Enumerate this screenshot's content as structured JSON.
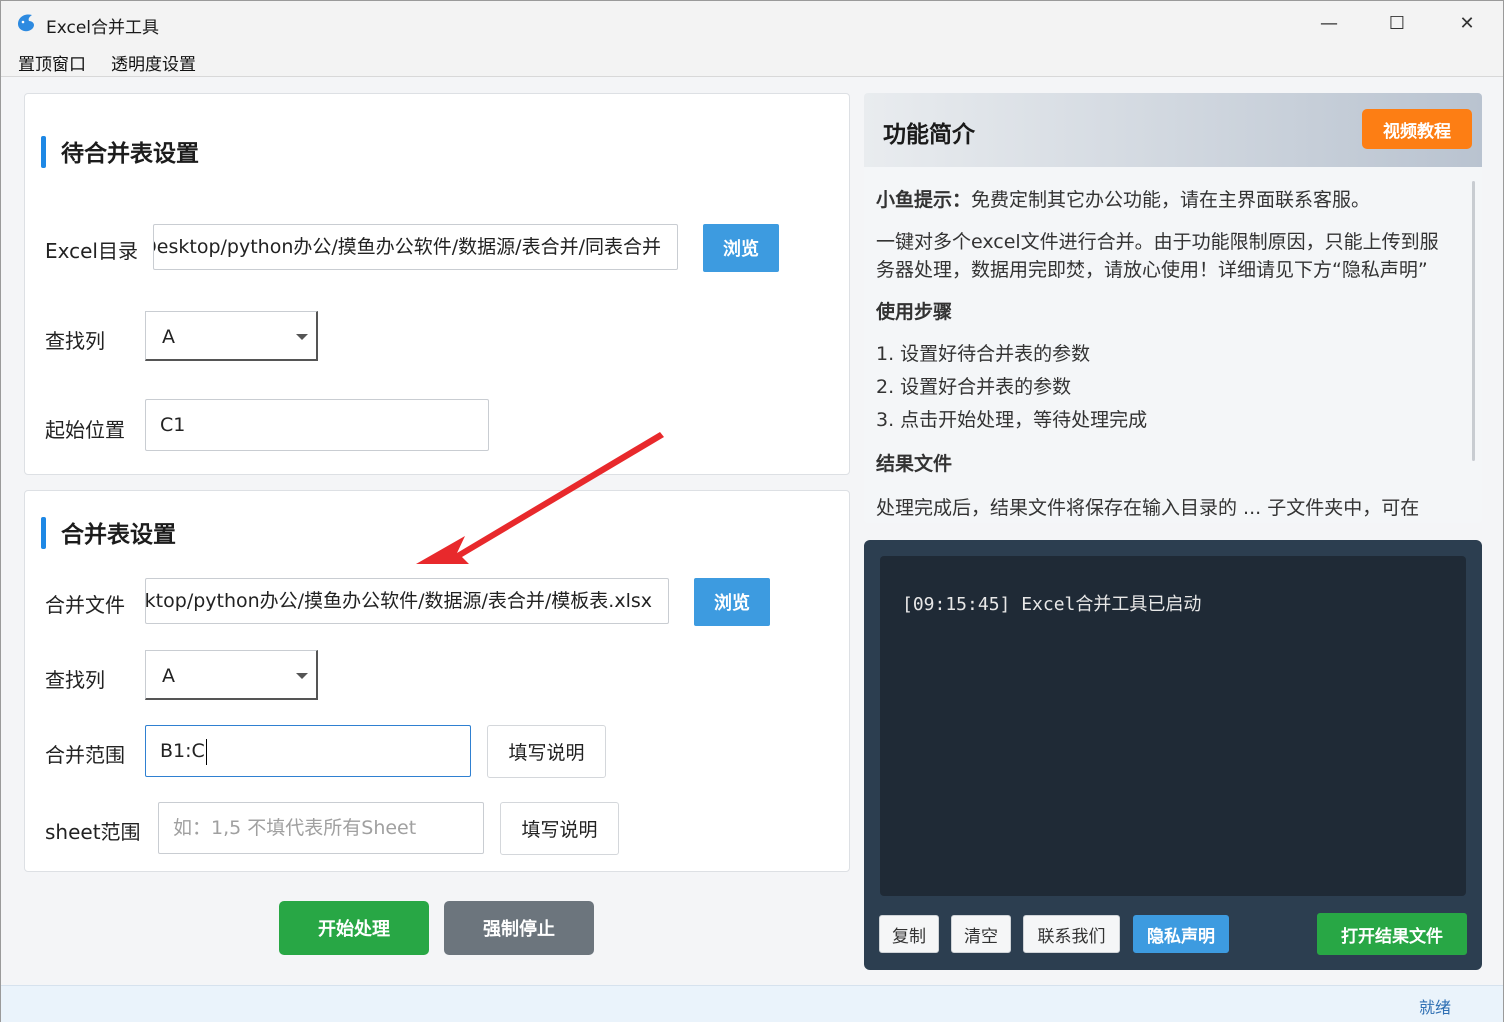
{
  "window": {
    "title": "Excel合并工具",
    "minimize_glyph": "—",
    "maximize_glyph": "☐",
    "close_glyph": "✕"
  },
  "menu": [
    "置顶窗口",
    "透明度设置"
  ],
  "source_section": {
    "title": "待合并表设置",
    "excel_dir_label": "Excel目录",
    "excel_dir_value": "C:/Users/Desktop/python办公/摸鱼办公软件/数据源/表合并/同表合并",
    "browse_label": "浏览",
    "lookup_col_label": "查找列",
    "lookup_col_value": "A",
    "start_pos_label": "起始位置",
    "start_pos_value": "C1"
  },
  "target_section": {
    "title": "合并表设置",
    "merge_file_label": "合并文件",
    "merge_file_value": "C:/Users/Desktop/python办公/摸鱼办公软件/数据源/表合并/模板表.xlsx",
    "browse_label": "浏览",
    "lookup_col_label": "查找列",
    "lookup_col_value": "A",
    "merge_range_label": "合并范围",
    "merge_range_value": "B1:C",
    "merge_range_help": "填写说明",
    "sheet_range_label": "sheet范围",
    "sheet_range_placeholder": "如：1,5 不填代表所有Sheet",
    "sheet_range_help": "填写说明"
  },
  "actions": {
    "start": "开始处理",
    "stop": "强制停止"
  },
  "intro": {
    "title": "功能简介",
    "video_button": "视频教程",
    "tip_label": "小鱼提示：",
    "tip_text": "免费定制其它办公功能，请在主界面联系客服。",
    "desc": "一键对多个excel文件进行合并。由于功能限制原因，只能上传到服务器处理，数据用完即焚，请放心使用！详细请见下方“隐私声明”",
    "steps_heading": "使用步骤",
    "steps": [
      "1. 设置好待合并表的参数",
      "2. 设置好合并表的参数",
      "3. 点击开始处理，等待处理完成"
    ],
    "result_heading": "结果文件",
    "result_partial": "处理完成后，结果文件将保存在输入目录的 ... 子文件夹中，可在"
  },
  "log": {
    "lines": [
      "[09:15:45] Excel合并工具已启动"
    ],
    "copy": "复制",
    "clear": "清空",
    "contact": "联系我们",
    "privacy": "隐私声明",
    "open_result": "打开结果文件"
  },
  "status": "就绪",
  "colors": {
    "accent_blue": "#3d9be0",
    "green": "#28a745",
    "gray": "#6c757d",
    "orange": "#fd7e14",
    "log_bg": "#2c3e50",
    "annotation_red": "#e8292c"
  }
}
